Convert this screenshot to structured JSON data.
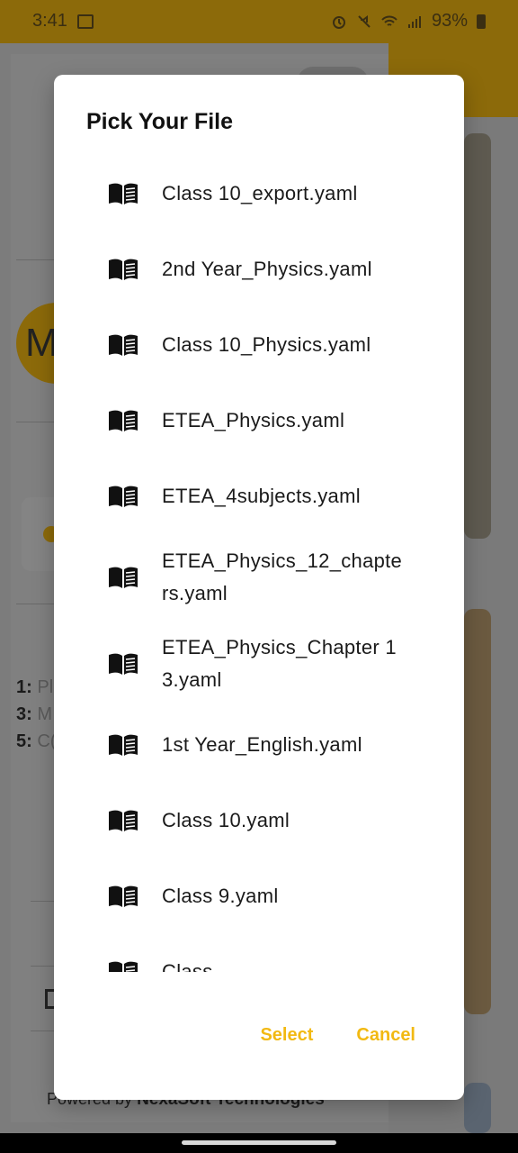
{
  "status_bar": {
    "time": "3:41",
    "battery": "93%",
    "icons": [
      "image-icon",
      "alarm-icon",
      "mute-icon",
      "wifi-icon",
      "signal-icon",
      "battery-icon"
    ]
  },
  "background_app": {
    "avatar_letter": "M",
    "legend": [
      {
        "num": "1:",
        "text": "Pl"
      },
      {
        "num": "3:",
        "text": "M"
      },
      {
        "num": "5:",
        "text": "C("
      }
    ],
    "powered_prefix": "Powered by",
    "powered_brand": "NexaSoft Technologies"
  },
  "dialog": {
    "title": "Pick Your File",
    "files": [
      "Class 10_export.yaml",
      "2nd Year_Physics.yaml",
      "Class 10_Physics.yaml",
      "ETEA_Physics.yaml",
      "ETEA_4subjects.yaml",
      "ETEA_Physics_12_chapters.yaml",
      "ETEA_Physics_Chapter 13.yaml",
      "1st Year_English.yaml",
      "Class 10.yaml",
      "Class 9.yaml",
      "Class"
    ],
    "select_label": "Select",
    "cancel_label": "Cancel",
    "accent": "#f2b912"
  }
}
